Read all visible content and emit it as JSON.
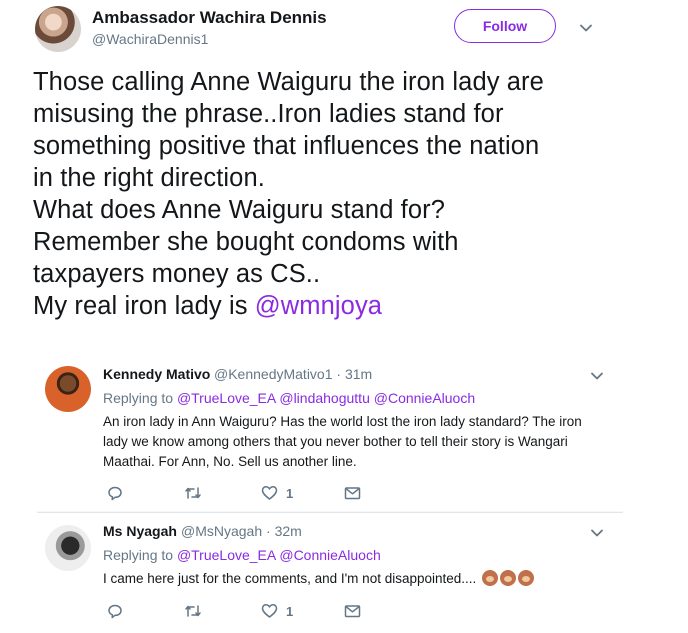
{
  "tweet": {
    "author_name": "Ambassador Wachira Dennis",
    "author_handle": "@WachiraDennis1",
    "follow_label": "Follow",
    "text_lines": [
      "Those calling Anne Waiguru the iron lady are",
      "misusing the phrase..Iron ladies stand for",
      "something positive that influences the nation",
      "in the right direction.",
      "What does Anne Waiguru stand for?",
      "Remember she bought condoms with",
      "taxpayers money as CS..",
      "My real iron lady is "
    ],
    "mention": "@wmnjoya"
  },
  "replies": [
    {
      "name": "Kennedy Mativo",
      "handle": "@KennedyMativo1 · 31m",
      "replying_prefix": "Replying to",
      "replying_to": "@TrueLove_EA @lindahoguttu @ConnieAluoch",
      "text": "An iron lady in Ann Waiguru? Has the world lost the iron lady standard? The iron lady we know among others that you never bother to tell their story is Wangari Maathai. For Ann, No. Sell us another line.",
      "like_count": "1"
    },
    {
      "name": "Ms Nyagah",
      "handle": "@MsNyagah · 32m",
      "replying_prefix": "Replying to",
      "replying_to": "@TrueLove_EA @ConnieAluoch",
      "text": "I came here just for the comments, and I'm not disappointed....",
      "like_count": "1"
    }
  ],
  "icons": {
    "reply": "reply-icon",
    "retweet": "retweet-icon",
    "like": "heart-icon",
    "message": "envelope-icon",
    "more": "chevron-down-icon",
    "emoji": "monkey-face-emoji"
  },
  "colors": {
    "accent": "#8a2be2",
    "secondary_text": "#657786",
    "reply_background": "#f5f8fa"
  }
}
